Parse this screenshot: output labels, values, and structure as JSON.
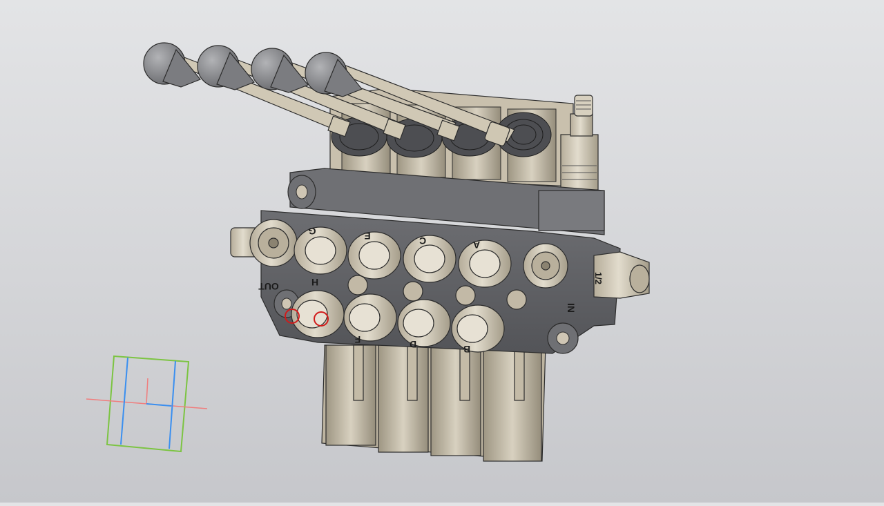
{
  "viewport": {
    "background_top": "#e3e4e6",
    "background_bottom": "#c6c7cb"
  },
  "model": {
    "name": "hydraulic-monoblock-valve-4-section",
    "body_color": "#5e5f62",
    "fitting_color": "#cfc6b4",
    "handle_color": "#8c8d90",
    "port_labels": {
      "out": "OUT",
      "in": "IN",
      "thread": "1/2",
      "g": "G",
      "e": "E",
      "c": "C",
      "a": "A",
      "h": "H",
      "f": "F",
      "d": "D",
      "b": "B"
    },
    "selected_edges_color": "#d21a1a"
  },
  "triad": {
    "x_axis_color": "#f07d7d",
    "y_axis_color": "#3a8ff0",
    "z_axis_color": "#7cc442"
  }
}
